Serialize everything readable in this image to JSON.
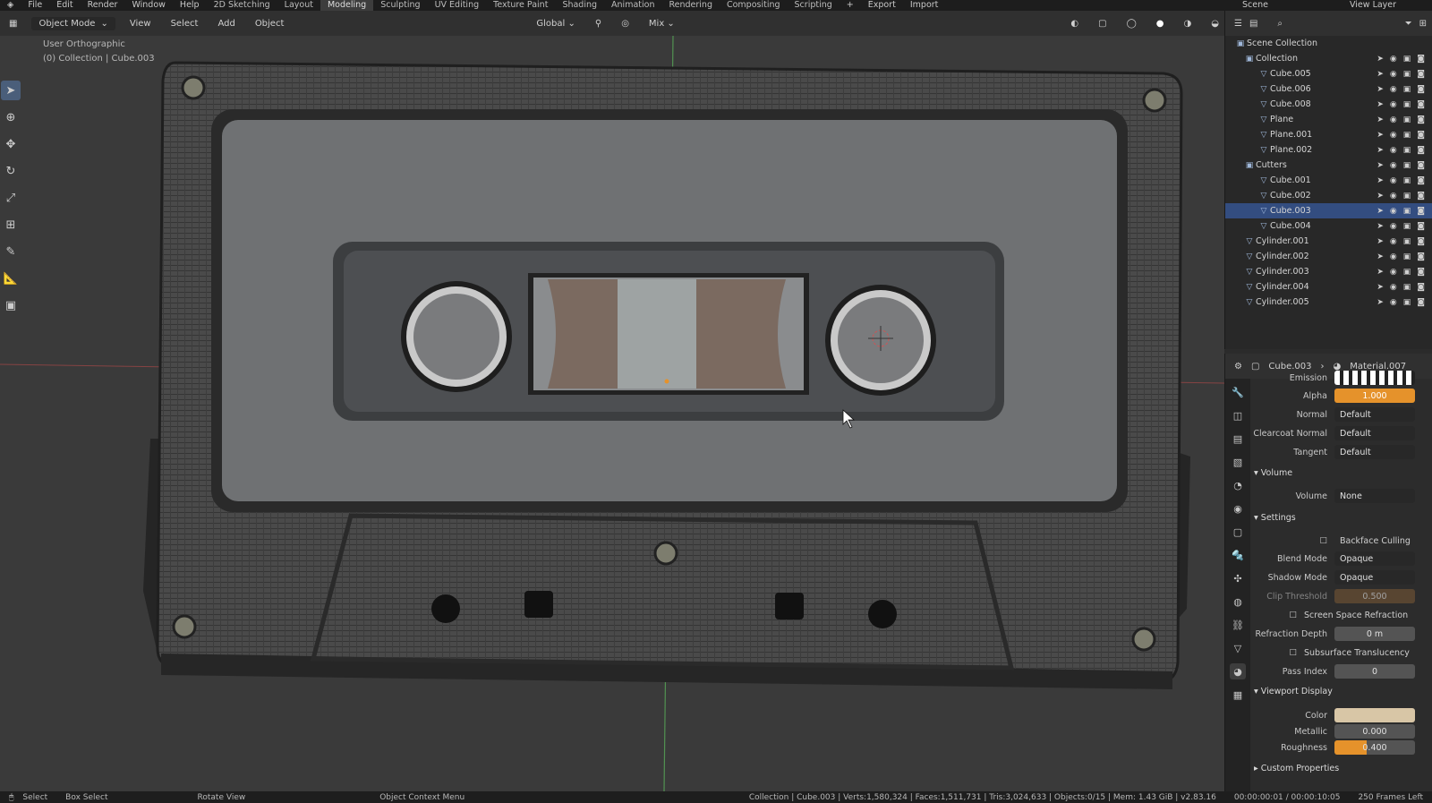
{
  "menu": {
    "items": [
      "File",
      "Edit",
      "Render",
      "Window",
      "Help"
    ],
    "workspaces": [
      "2D Sketching",
      "Layout",
      "Modeling",
      "Sculpting",
      "UV Editing",
      "Texture Paint",
      "Shading",
      "Animation",
      "Rendering",
      "Compositing",
      "Scripting"
    ],
    "active_workspace": "Modeling",
    "export_label": "Export",
    "import_label": "Import",
    "scene_label": "Scene",
    "view_layer_label": "View Layer"
  },
  "header": {
    "mode": "Object Mode",
    "view": "View",
    "select": "Select",
    "add": "Add",
    "object": "Object",
    "orientation": "Global",
    "pivot": "Mix"
  },
  "viewport": {
    "view_name": "User Orthographic",
    "collection_info": "(0) Collection | Cube.003"
  },
  "outliner": {
    "root": "Scene Collection",
    "rows": [
      {
        "name": "Collection",
        "type": "collection"
      },
      {
        "name": "Cube.005",
        "type": "mesh"
      },
      {
        "name": "Cube.006",
        "type": "mesh"
      },
      {
        "name": "Cube.008",
        "type": "mesh"
      },
      {
        "name": "Plane",
        "type": "mesh"
      },
      {
        "name": "Plane.001",
        "type": "mesh"
      },
      {
        "name": "Plane.002",
        "type": "mesh"
      },
      {
        "name": "Cutters",
        "type": "collection"
      },
      {
        "name": "Cube.001",
        "type": "mesh"
      },
      {
        "name": "Cube.002",
        "type": "mesh"
      },
      {
        "name": "Cube.003",
        "type": "mesh"
      },
      {
        "name": "Cube.004",
        "type": "mesh"
      },
      {
        "name": "Cylinder.001",
        "type": "mesh"
      },
      {
        "name": "Cylinder.002",
        "type": "mesh"
      },
      {
        "name": "Cylinder.003",
        "type": "mesh"
      },
      {
        "name": "Cylinder.004",
        "type": "mesh"
      },
      {
        "name": "Cylinder.005",
        "type": "mesh"
      }
    ]
  },
  "properties": {
    "object": "Cube.003",
    "material": "Material.007",
    "emission_label": "Emission",
    "alpha_label": "Alpha",
    "alpha_value": "1.000",
    "normal_label": "Normal",
    "normal_value": "Default",
    "clearcoat_label": "Clearcoat Normal",
    "clearcoat_value": "Default",
    "tangent_label": "Tangent",
    "tangent_value": "Default",
    "volume_section": "Volume",
    "volume_label": "Volume",
    "volume_value": "None",
    "settings_section": "Settings",
    "backface_label": "Backface Culling",
    "blend_label": "Blend Mode",
    "blend_value": "Opaque",
    "shadow_label": "Shadow Mode",
    "shadow_value": "Opaque",
    "clip_label": "Clip Threshold",
    "clip_value": "0.500",
    "ssr_label": "Screen Space Refraction",
    "refraction_label": "Refraction Depth",
    "refraction_value": "0 m",
    "sss_label": "Subsurface Translucency",
    "pass_label": "Pass Index",
    "pass_value": "0",
    "viewport_section": "Viewport Display",
    "color_label": "Color",
    "metallic_label": "Metallic",
    "metallic_value": "0.000",
    "roughness_label": "Roughness",
    "roughness_value": "0.400",
    "custom_section": "Custom Properties"
  },
  "status": {
    "select": "Select",
    "box_select": "Box Select",
    "rotate_view": "Rotate View",
    "context_menu": "Object Context Menu",
    "stats": "Collection | Cube.003 | Verts:1,580,324 | Faces:1,511,731 | Tris:3,024,633 | Objects:0/15 | Mem: 1.43 GiB | v2.83.16",
    "time": "00:00:00:01 / 00:00:10:05",
    "frames": "250 Frames Left"
  },
  "colors": {
    "accent": "#e5922b",
    "active_tool": "#4a5e7a",
    "x_axis": "#b94a4a",
    "y_axis": "#5cb85c"
  }
}
